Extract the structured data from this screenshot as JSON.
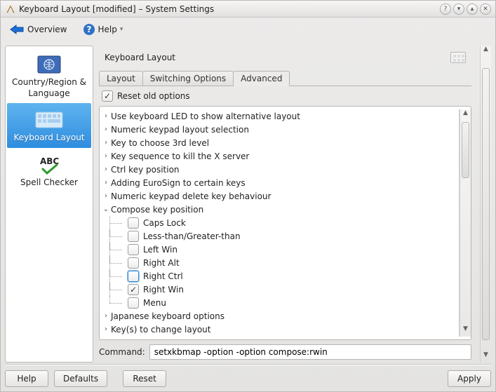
{
  "window": {
    "title": "Keyboard Layout [modified] – System Settings"
  },
  "toolbar": {
    "overview": "Overview",
    "help": "Help"
  },
  "sidebar": {
    "items": [
      {
        "label": "Country/Region & Language"
      },
      {
        "label": "Keyboard Layout"
      },
      {
        "label": "Spell Checker"
      }
    ]
  },
  "main": {
    "title": "Keyboard Layout",
    "tabs": [
      {
        "label": "Layout",
        "active": false
      },
      {
        "label": "Switching Options",
        "active": false
      },
      {
        "label": "Advanced",
        "active": true
      }
    ],
    "reset_old": "Reset old options",
    "tree": [
      {
        "label": "Use keyboard LED to show alternative layout"
      },
      {
        "label": "Numeric keypad layout selection"
      },
      {
        "label": "Key to choose 3rd level"
      },
      {
        "label": "Key sequence to kill the X server"
      },
      {
        "label": "Ctrl key position"
      },
      {
        "label": "Adding EuroSign to certain keys"
      },
      {
        "label": "Numeric keypad delete key behaviour"
      },
      {
        "label": "Compose key position",
        "expanded": true,
        "children": [
          {
            "label": "Caps Lock",
            "checked": false
          },
          {
            "label": "Less-than/Greater-than",
            "checked": false
          },
          {
            "label": "Left Win",
            "checked": false
          },
          {
            "label": "Right Alt",
            "checked": false
          },
          {
            "label": "Right Ctrl",
            "checked": false,
            "highlighted": true
          },
          {
            "label": "Right Win",
            "checked": true
          },
          {
            "label": "Menu",
            "checked": false
          }
        ]
      },
      {
        "label": "Japanese keyboard options"
      },
      {
        "label": "Key(s) to change layout"
      }
    ],
    "command_label": "Command:",
    "command_value": "setxkbmap -option -option compose:rwin"
  },
  "footer": {
    "help": "Help",
    "defaults": "Defaults",
    "reset": "Reset",
    "apply": "Apply"
  }
}
